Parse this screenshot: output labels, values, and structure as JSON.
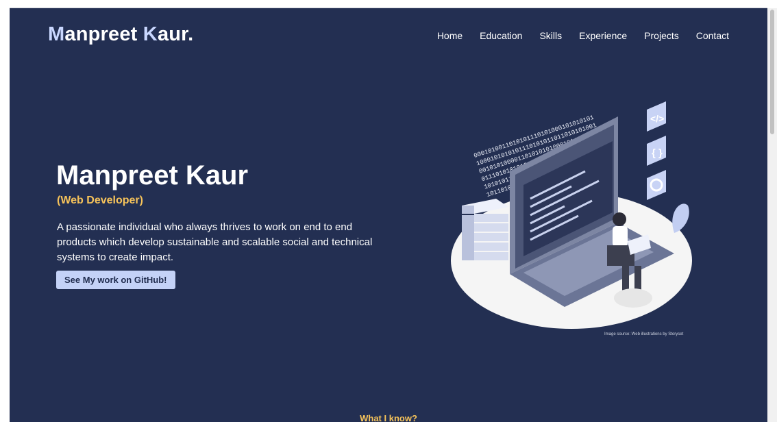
{
  "header": {
    "logo_first": "M",
    "logo_part1": "anpreet ",
    "logo_k": "K",
    "logo_part2": "aur."
  },
  "nav": {
    "items": [
      "Home",
      "Education",
      "Skills",
      "Experience",
      "Projects",
      "Contact"
    ]
  },
  "hero": {
    "name": "Manpreet Kaur",
    "role": "(Web Developer)",
    "description": "A passionate individual who always thrives to work on end to end products which develop sustainable and scalable social and technical systems to create impact.",
    "button_label": "See My work on GitHub!",
    "image_credit": "Image source: Web illustrations by Storyset",
    "binary_lines": [
      "0001010011010101110101000101010101",
      "1000101010101110101011011010101001",
      "0010101000011010101010001011010001",
      "0111010101010101110101010101010010",
      "1010101100011010101010001001011010",
      "1011010100011010101010100010101010"
    ]
  },
  "sections": {
    "next_title": "What I know?"
  },
  "colors": {
    "background": "#232f52",
    "accent_yellow": "#f6c35a",
    "accent_lavender": "#c4d2f7"
  }
}
